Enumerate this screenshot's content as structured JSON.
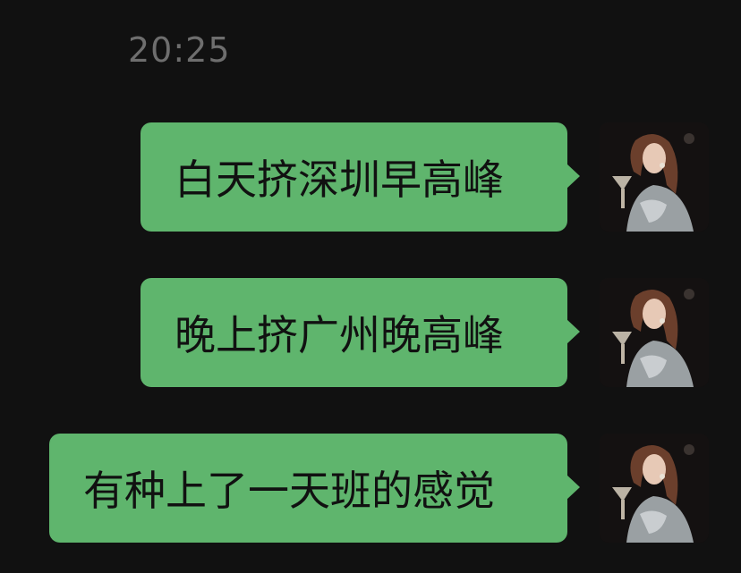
{
  "chat": {
    "timestamp": "20:25",
    "messages": [
      {
        "text": "白天挤深圳早高峰",
        "sender": "self",
        "avatar_icon": "user-avatar"
      },
      {
        "text": "晚上挤广州晚高峰",
        "sender": "self",
        "avatar_icon": "user-avatar"
      },
      {
        "text": "有种上了一天班的感觉",
        "sender": "self",
        "avatar_icon": "user-avatar"
      }
    ]
  },
  "colors": {
    "background": "#111111",
    "bubble": "#5fb56d",
    "timestamp": "#6e6e6e",
    "text": "#111111"
  }
}
